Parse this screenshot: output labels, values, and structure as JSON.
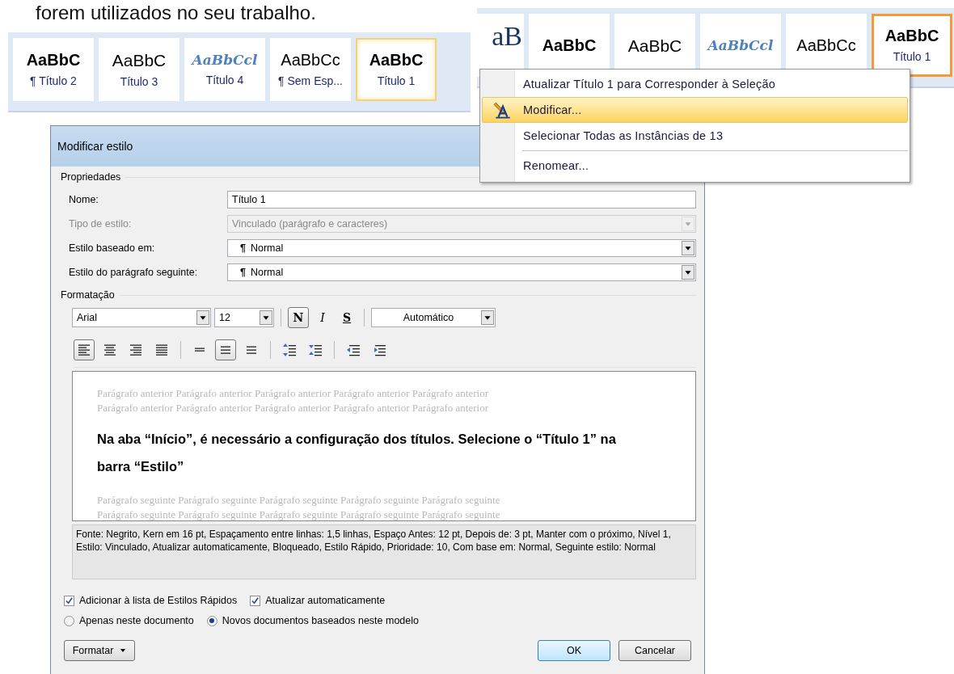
{
  "intro_text": "forem utilizados no seu trabalho.",
  "style_gallery": {
    "items": [
      {
        "sample": "AaBbC",
        "label": "¶ Título 2",
        "kind": "heading2",
        "selected": false
      },
      {
        "sample": "AaBbC",
        "label": "Título 3",
        "kind": "heading3",
        "selected": false
      },
      {
        "sample": "AaBbCcl",
        "label": "Título 4",
        "kind": "heading4",
        "selected": false
      },
      {
        "sample": "AaBbCc",
        "label": "¶ Sem Esp...",
        "kind": "nospacing",
        "selected": false
      },
      {
        "sample": "AaBbC",
        "label": "Título 1",
        "kind": "heading1",
        "selected": true
      }
    ]
  },
  "style_gallery_2": {
    "items": [
      {
        "sample": "aB",
        "kind": "title",
        "selected": false
      },
      {
        "sample": "AaBbC",
        "kind": "heading2",
        "selected": false
      },
      {
        "sample": "AaBbC",
        "kind": "heading3",
        "selected": false
      },
      {
        "sample": "AaBbCcl",
        "kind": "heading4",
        "selected": false
      },
      {
        "sample": "AaBbCc",
        "kind": "nospacing",
        "selected": false
      },
      {
        "sample": "AaBbC",
        "label": "Título 1",
        "kind": "heading1",
        "selected": true
      }
    ]
  },
  "context_menu": {
    "items": [
      {
        "kind": "item",
        "label": "Atualizar Título 1 para Corresponder à Seleção",
        "icon": false,
        "selected": false
      },
      {
        "kind": "item",
        "label": "Modificar...",
        "icon": true,
        "selected": true
      },
      {
        "kind": "item",
        "label": "Selecionar Todas as Instâncias de 13",
        "icon": false,
        "selected": false
      },
      {
        "kind": "separator"
      },
      {
        "kind": "item",
        "label": "Renomear...",
        "icon": false,
        "selected": false
      }
    ]
  },
  "dialog": {
    "title": "Modificar estilo",
    "properties": {
      "heading": "Propriedades",
      "fields": [
        {
          "label": "Nome:",
          "value": "Título 1",
          "kind": "text",
          "disabled": false
        },
        {
          "label": "Tipo de estilo:",
          "value": "Vinculado (parágrafo e caracteres)",
          "kind": "dropdown",
          "disabled": true
        },
        {
          "label": "Estilo baseado em:",
          "value": "Normal",
          "mark": "¶",
          "kind": "dropdown",
          "disabled": false
        },
        {
          "label": "Estilo do parágrafo seguinte:",
          "value": "Normal",
          "mark": "¶",
          "kind": "dropdown",
          "disabled": false
        }
      ]
    },
    "formatting": {
      "heading": "Formatação",
      "font": "Arial",
      "size": "12",
      "styles": [
        {
          "label": "N",
          "kind": "bold",
          "selected": true
        },
        {
          "label": "I",
          "kind": "italic",
          "selected": false
        },
        {
          "label": "S",
          "kind": "underline",
          "selected": false
        }
      ],
      "text_color_choice": "Automático",
      "paragraph_buttons": [
        {
          "kind": "align-left",
          "selected": true
        },
        {
          "kind": "align-center",
          "selected": false
        },
        {
          "kind": "align-right",
          "selected": false
        },
        {
          "kind": "justify",
          "selected": false
        },
        {
          "kind": "single-spacing",
          "selected": false
        },
        {
          "kind": "one-half-spacing",
          "selected": true
        },
        {
          "kind": "double-spacing",
          "selected": false
        },
        {
          "kind": "spacing-increase",
          "selected": false
        },
        {
          "kind": "spacing-decrease",
          "selected": false
        },
        {
          "kind": "indent-decrease",
          "selected": false
        },
        {
          "kind": "indent-increase",
          "selected": false
        }
      ]
    },
    "preview": {
      "previous_lines": [
        "Parágrafo anterior Parágrafo anterior Parágrafo anterior Parágrafo anterior Parágrafo anterior",
        "Parágrafo anterior Parágrafo anterior Parágrafo anterior Parágrafo anterior Parágrafo anterior"
      ],
      "sample_text": "Na aba “Início”, é necessário a configuração dos títulos. Selecione o “Título 1” na barra “Estilo”",
      "following_lines": [
        "Parágrafo seguinte Parágrafo seguinte Parágrafo seguinte Parágrafo seguinte Parágrafo seguinte",
        "Parágrafo seguinte Parágrafo seguinte Parágrafo seguinte Parágrafo seguinte Parágrafo seguinte"
      ]
    },
    "description": "Fonte: Negrito, Kern em 16 pt, Espaçamento entre linhas:  1,5 linhas, Espaço Antes:  12 pt, Depois de:  3 pt, Manter com o próximo, Nível 1, Estilo: Vinculado, Atualizar automaticamente, Bloqueado, Estilo Rápido, Prioridade: 10, Com base em: Normal, Seguinte estilo: Normal",
    "checkboxes": [
      {
        "label": "Adicionar à lista de Estilos Rápidos",
        "checked": true
      },
      {
        "label": "Atualizar automaticamente",
        "checked": true
      }
    ],
    "radios": [
      {
        "label": "Apenas neste documento",
        "selected": false
      },
      {
        "label": "Novos documentos baseados neste modelo",
        "selected": true
      }
    ],
    "format_button": "Formatar",
    "ok_button": "OK",
    "cancel_button": "Cancelar"
  }
}
